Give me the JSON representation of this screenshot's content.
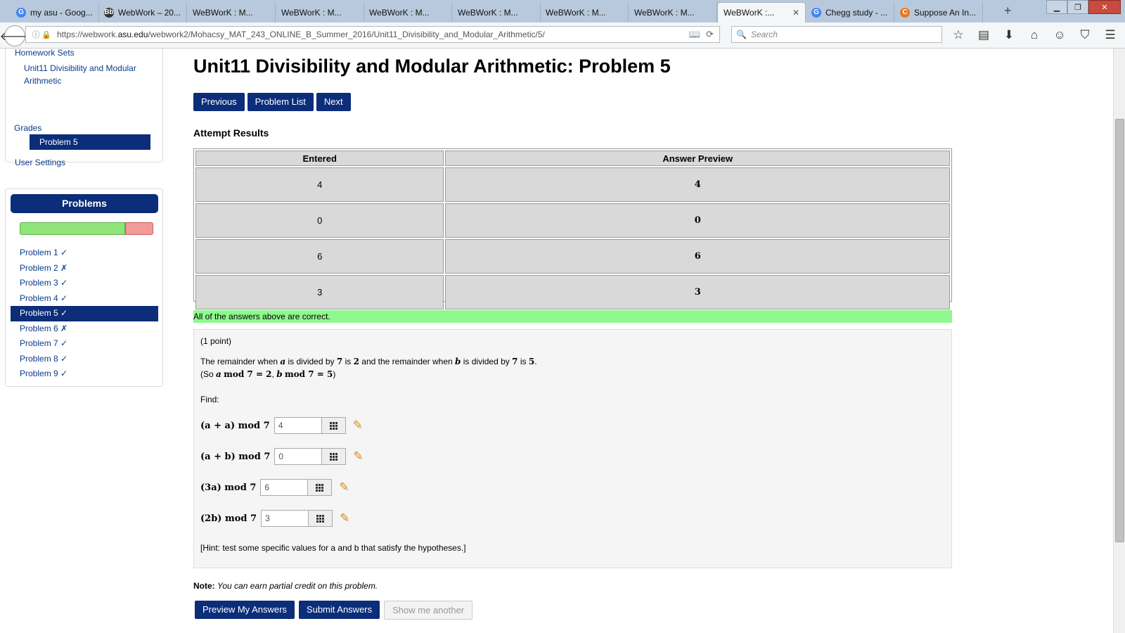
{
  "browser": {
    "tabs": [
      {
        "title": "my asu - Goog...",
        "icon": "google-icon",
        "color": "#4285f4",
        "glyph": "G"
      },
      {
        "title": "WebWork – 20...",
        "icon": "bb-icon",
        "color": "#333333",
        "glyph": "Bb"
      },
      {
        "title": "WeBWorK : M...",
        "icon": "",
        "color": "",
        "glyph": ""
      },
      {
        "title": "WeBWorK : M...",
        "icon": "",
        "color": "",
        "glyph": ""
      },
      {
        "title": "WeBWorK : M...",
        "icon": "",
        "color": "",
        "glyph": ""
      },
      {
        "title": "WeBWorK : M...",
        "icon": "",
        "color": "",
        "glyph": ""
      },
      {
        "title": "WeBWorK : M...",
        "icon": "",
        "color": "",
        "glyph": ""
      },
      {
        "title": "WeBWorK : M...",
        "icon": "",
        "color": "",
        "glyph": ""
      },
      {
        "title": "WeBWorK :...",
        "icon": "",
        "color": "",
        "glyph": "",
        "active": true
      },
      {
        "title": "Chegg study - ...",
        "icon": "google-icon",
        "color": "#4285f4",
        "glyph": "G"
      },
      {
        "title": "Suppose An In...",
        "icon": "chegg-icon",
        "color": "#e87722",
        "glyph": "C"
      }
    ],
    "url_prefix": "https://webwork.",
    "url_domain": "asu.edu",
    "url_path": "/webwork2/Mohacsy_MAT_243_ONLINE_B_Summer_2016/Unit11_Divisibility_and_Modular_Arithmetic/5/",
    "search_placeholder": "Search"
  },
  "sidebar": {
    "homework_sets": "Homework Sets",
    "set_name": "Unit11 Divisibility and Modular Arithmetic",
    "current_problem": "Problem 5",
    "user_settings": "User Settings",
    "grades": "Grades",
    "problems_header": "Problems",
    "progress": {
      "correct_fraction": 0.78
    },
    "problems": [
      {
        "label": "Problem 1 ✓"
      },
      {
        "label": "Problem 2 ✗"
      },
      {
        "label": "Problem 3 ✓"
      },
      {
        "label": "Problem 4 ✓"
      },
      {
        "label": "Problem 5 ✓",
        "current": true
      },
      {
        "label": "Problem 6 ✗"
      },
      {
        "label": "Problem 7 ✓"
      },
      {
        "label": "Problem 8 ✓"
      },
      {
        "label": "Problem 9 ✓"
      }
    ]
  },
  "main": {
    "title": "Unit11 Divisibility and Modular Arithmetic: Problem 5",
    "nav": {
      "previous": "Previous",
      "list": "Problem List",
      "next": "Next"
    },
    "attempt_title": "Attempt Results",
    "results": {
      "headers": [
        "Entered",
        "Answer Preview"
      ],
      "rows": [
        [
          "4",
          "4"
        ],
        [
          "0",
          "0"
        ],
        [
          "6",
          "6"
        ],
        [
          "3",
          "3"
        ]
      ]
    },
    "correct_message": "All of the answers above are correct.",
    "problem": {
      "points": "(1 point)",
      "find": "Find:",
      "hint": "[Hint: test some specific values for a and b that satisfy the hypotheses.]",
      "questions": [
        {
          "label": "(a + a) mod 7",
          "value": "4"
        },
        {
          "label": "(a + b) mod 7",
          "value": "0"
        },
        {
          "label": "(3a) mod 7",
          "value": "6"
        },
        {
          "label": "(2b) mod 7",
          "value": "3"
        }
      ]
    },
    "note_label": "Note:",
    "note_text": "You can earn partial credit on this problem.",
    "buttons": {
      "preview": "Preview My Answers",
      "submit": "Submit Answers",
      "another": "Show me another"
    }
  },
  "colors": {
    "accent": "#0b2d7a",
    "correct": "#8ff88f",
    "progress_good": "#8fe47a",
    "progress_bad": "#f19a9a"
  }
}
